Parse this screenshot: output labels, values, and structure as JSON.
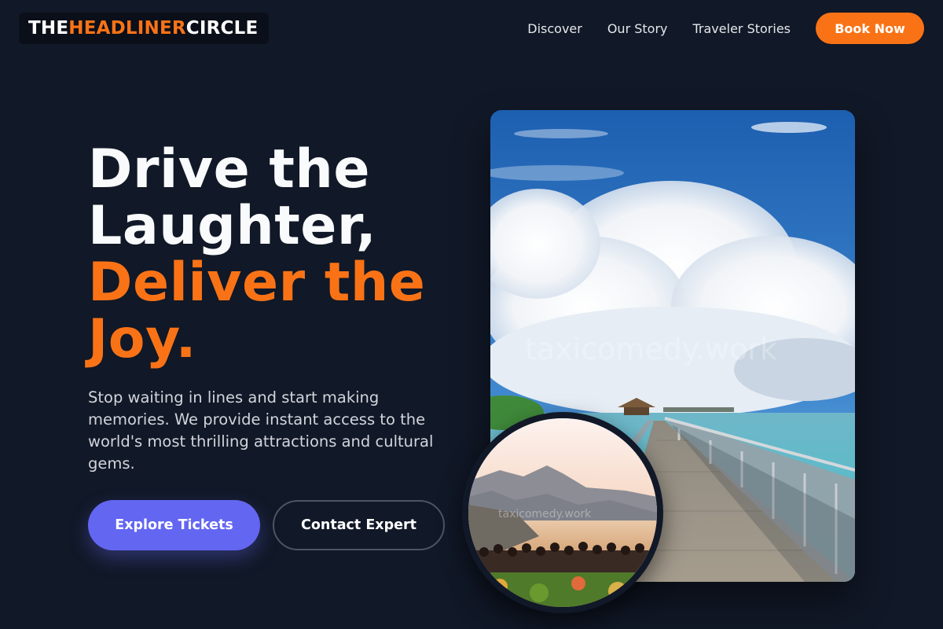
{
  "header": {
    "logo": {
      "part1": "THE ",
      "part2": "HEADLINER",
      "part3": " CIRCLE"
    },
    "nav": [
      {
        "label": "Discover"
      },
      {
        "label": "Our Story"
      },
      {
        "label": "Traveler Stories"
      }
    ],
    "cta_label": "Book Now"
  },
  "hero": {
    "headline_line1": "Drive the",
    "headline_line2": "Laughter,",
    "headline_line3": "Deliver the",
    "headline_line4": "Joy.",
    "subtext": "Stop waiting in lines and start making memories. We provide instant access to the world's most thrilling attractions and cultural gems.",
    "primary_button": "Explore Tickets",
    "secondary_button": "Contact Expert"
  },
  "images": {
    "main_watermark": "taxicomedy.work",
    "main_icon": "boardwalk-ocean-photo",
    "circle_watermark": "taxicomedy.work",
    "circle_icon": "crowd-mountain-sunset-photo"
  },
  "colors": {
    "background": "#111827",
    "accent": "#f97316",
    "primary": "#6366f1"
  }
}
